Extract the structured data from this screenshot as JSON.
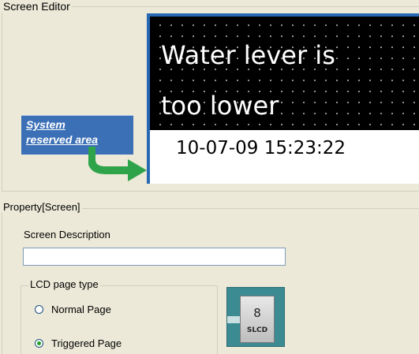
{
  "screen_editor": {
    "title": "Screen Editor",
    "lcd": {
      "line1": "Water lever is",
      "line2": "too lower",
      "datetime": "10-07-09 15:23:22"
    },
    "reserved_area": {
      "line1": "System",
      "line2": "reserved area"
    }
  },
  "property": {
    "title": "Property[Screen]",
    "description_label": "Screen Description",
    "description_value": "",
    "lcd_page_type": {
      "title": "LCD page type",
      "options": [
        {
          "label": "Normal  Page",
          "checked": false
        },
        {
          "label": "Triggered Page",
          "checked": true
        }
      ]
    },
    "slcd_icon": {
      "number": "8",
      "text": "SLCD"
    }
  },
  "colors": {
    "window_bg": "#ece9d8",
    "lcd_border": "#2668b3",
    "reserved_label_bg": "#3b6fb6",
    "arrow": "#2fa34a",
    "radio_checked": "#21a121",
    "slcd_bg": "#3c8a92"
  }
}
